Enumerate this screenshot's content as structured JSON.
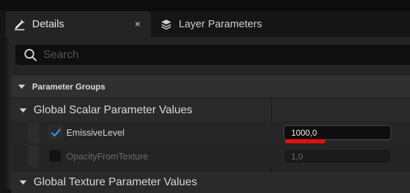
{
  "tabs": [
    {
      "label": "Details",
      "icon": "edit-details-icon",
      "close": "×"
    },
    {
      "label": "Layer Parameters",
      "icon": "layers-icon"
    }
  ],
  "search": {
    "placeholder": "Search",
    "value": ""
  },
  "parameter_groups": {
    "label": "Parameter Groups"
  },
  "scalar_section": {
    "label": "Global Scalar Parameter Values",
    "params": [
      {
        "name": "EmissiveLevel",
        "value": "1000,0",
        "checked": true
      },
      {
        "name": "OpacityFromTexture",
        "value": "1,0",
        "checked": false
      }
    ]
  },
  "texture_section": {
    "label": "Global Texture Parameter Values"
  },
  "colors": {
    "accent": "#2f8ee0",
    "highlight": "#e01010",
    "panel": "#242424"
  }
}
